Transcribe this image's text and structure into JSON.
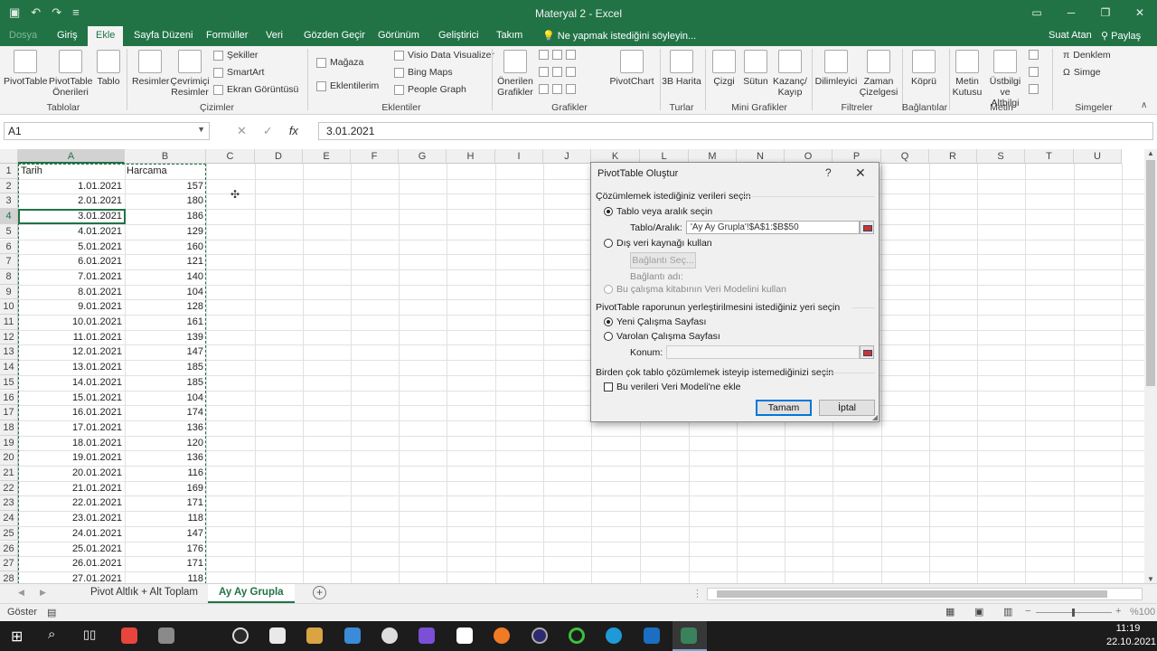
{
  "window": {
    "title": "Materyal 2 - Excel"
  },
  "ribbon_tabs": [
    "Dosya",
    "Giriş",
    "Ekle",
    "Sayfa Düzeni",
    "Formüller",
    "Veri",
    "Gözden Geçir",
    "Görünüm",
    "Geliştirici",
    "Takım"
  ],
  "tell_me": "Ne yapmak istediğini söyleyin...",
  "user": {
    "name": "Suat Atan",
    "share": "Paylaş"
  },
  "ribbon": {
    "pivottable": "PivotTable",
    "pivottable_rec_1": "PivotTable",
    "pivottable_rec_2": "Önerileri",
    "table": "Tablo",
    "images": "Resimler",
    "online_1": "Çevrimiçi",
    "online_2": "Resimler",
    "shapes": "Şekiller",
    "smartart": "SmartArt",
    "screenshot": "Ekran Görüntüsü",
    "store": "Mağaza",
    "addins": "Eklentilerim",
    "visio": "Visio Data Visualizer",
    "bing": "Bing Maps",
    "people": "People Graph",
    "rec_charts_1": "Önerilen",
    "rec_charts_2": "Grafikler",
    "pivotchart": "PivotChart",
    "map3d": "3B Harita",
    "line": "Çizgi",
    "column": "Sütun",
    "winloss_1": "Kazanç/",
    "winloss_2": "Kayıp",
    "slicer": "Dilimleyici",
    "timeline_1": "Zaman",
    "timeline_2": "Çizelgesi",
    "link": "Köprü",
    "textbox_1": "Metin",
    "textbox_2": "Kutusu",
    "header_1": "Üstbilgi",
    "header_2": "ve Altbilgi",
    "equation": "Denklem",
    "symbol": "Simge",
    "groups": {
      "tables": "Tablolar",
      "illustrations": "Çizimler",
      "addins": "Eklentiler",
      "charts": "Grafikler",
      "tours": "Turlar",
      "sparklines": "Mini Grafikler",
      "filters": "Filtreler",
      "links": "Bağlantılar",
      "text": "Metin",
      "symbols": "Simgeler"
    }
  },
  "formula_bar": {
    "namebox": "A1",
    "value": "3.01.2021",
    "fx": "fx"
  },
  "columns": [
    "A",
    "B",
    "C",
    "D",
    "E",
    "F",
    "G",
    "H",
    "I",
    "J",
    "K",
    "L",
    "M",
    "N",
    "O",
    "P",
    "Q",
    "R",
    "S",
    "T",
    "U"
  ],
  "sheet": {
    "header": {
      "a": "Tarih",
      "b": "Harcama"
    },
    "rows": [
      {
        "n": "2",
        "a": "1.01.2021",
        "b": "157"
      },
      {
        "n": "3",
        "a": "2.01.2021",
        "b": "180"
      },
      {
        "n": "4",
        "a": "3.01.2021",
        "b": "186"
      },
      {
        "n": "5",
        "a": "4.01.2021",
        "b": "129"
      },
      {
        "n": "6",
        "a": "5.01.2021",
        "b": "160"
      },
      {
        "n": "7",
        "a": "6.01.2021",
        "b": "121"
      },
      {
        "n": "8",
        "a": "7.01.2021",
        "b": "140"
      },
      {
        "n": "9",
        "a": "8.01.2021",
        "b": "104"
      },
      {
        "n": "10",
        "a": "9.01.2021",
        "b": "128"
      },
      {
        "n": "11",
        "a": "10.01.2021",
        "b": "161"
      },
      {
        "n": "12",
        "a": "11.01.2021",
        "b": "139"
      },
      {
        "n": "13",
        "a": "12.01.2021",
        "b": "147"
      },
      {
        "n": "14",
        "a": "13.01.2021",
        "b": "185"
      },
      {
        "n": "15",
        "a": "14.01.2021",
        "b": "185"
      },
      {
        "n": "16",
        "a": "15.01.2021",
        "b": "104"
      },
      {
        "n": "17",
        "a": "16.01.2021",
        "b": "174"
      },
      {
        "n": "18",
        "a": "17.01.2021",
        "b": "136"
      },
      {
        "n": "19",
        "a": "18.01.2021",
        "b": "120"
      },
      {
        "n": "20",
        "a": "19.01.2021",
        "b": "136"
      },
      {
        "n": "21",
        "a": "20.01.2021",
        "b": "116"
      },
      {
        "n": "22",
        "a": "21.01.2021",
        "b": "169"
      },
      {
        "n": "23",
        "a": "22.01.2021",
        "b": "171"
      },
      {
        "n": "24",
        "a": "23.01.2021",
        "b": "118"
      },
      {
        "n": "25",
        "a": "24.01.2021",
        "b": "147"
      },
      {
        "n": "26",
        "a": "25.01.2021",
        "b": "176"
      },
      {
        "n": "27",
        "a": "26.01.2021",
        "b": "171"
      },
      {
        "n": "28",
        "a": "27.01.2021",
        "b": "118"
      }
    ]
  },
  "dialog": {
    "title": "PivotTable Oluştur",
    "help": "?",
    "close": "✕",
    "section1": "Çözümlemek istediğiniz verileri seçin",
    "opt_table": "Tablo veya aralık seçin",
    "range_label": "Tablo/Aralık:",
    "range_value": "'Ay Ay Grupla'!$A$1:$B$50",
    "opt_external": "Dış veri kaynağı kullan",
    "choose_conn": "Bağlantı Seç...",
    "conn_name": "Bağlantı adı:",
    "opt_model": "Bu çalışma kitabının Veri Modelini kullan",
    "section2": "PivotTable raporunun yerleştirilmesini istediğiniz yeri seçin",
    "opt_new": "Yeni Çalışma Sayfası",
    "opt_existing": "Varolan Çalışma Sayfası",
    "location_label": "Konum:",
    "section3": "Birden çok tablo çözümlemek isteyip istemediğinizi seçin",
    "add_model": "Bu verileri Veri Modeli'ne ekle",
    "ok": "Tamam",
    "cancel": "İptal"
  },
  "sheet_tabs": [
    "Pivot Altlık + Alt Toplam",
    "Ay Ay Grupla"
  ],
  "status": {
    "mode": "Göster",
    "zoom": "%100"
  },
  "taskbar": {
    "time": "11:19",
    "date": "22.10.2021"
  }
}
